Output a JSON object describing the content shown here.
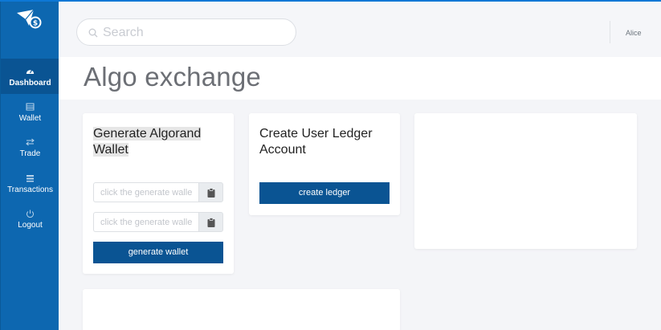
{
  "sidebar": {
    "items": [
      {
        "label": "Dashboard",
        "icon": "dashboard-icon",
        "active": true
      },
      {
        "label": "Wallet",
        "icon": "wallet-icon",
        "active": false
      },
      {
        "label": "Trade",
        "icon": "trade-icon",
        "active": false
      },
      {
        "label": "Transactions",
        "icon": "transactions-icon",
        "active": false
      },
      {
        "label": "Logout",
        "icon": "power-icon",
        "active": false
      }
    ]
  },
  "topbar": {
    "search_placeholder": "Search",
    "user_name": "Alice"
  },
  "header": {
    "title": "Algo exchange"
  },
  "generate_card": {
    "title_line1": "Generate Algorand",
    "title_line2": "Wallet",
    "field1_placeholder": "click the generate wallet",
    "field2_placeholder": "click the generate wallet",
    "button_label": "generate wallet"
  },
  "ledger_card": {
    "title_line1": "Create User Ledger",
    "title_line2": "Account",
    "button_label": "create ledger"
  },
  "colors": {
    "sidebar_bg": "#0d67b0",
    "sidebar_active": "#0a5493",
    "primary_button": "#0a5493",
    "page_bg": "#f4f5f8"
  }
}
